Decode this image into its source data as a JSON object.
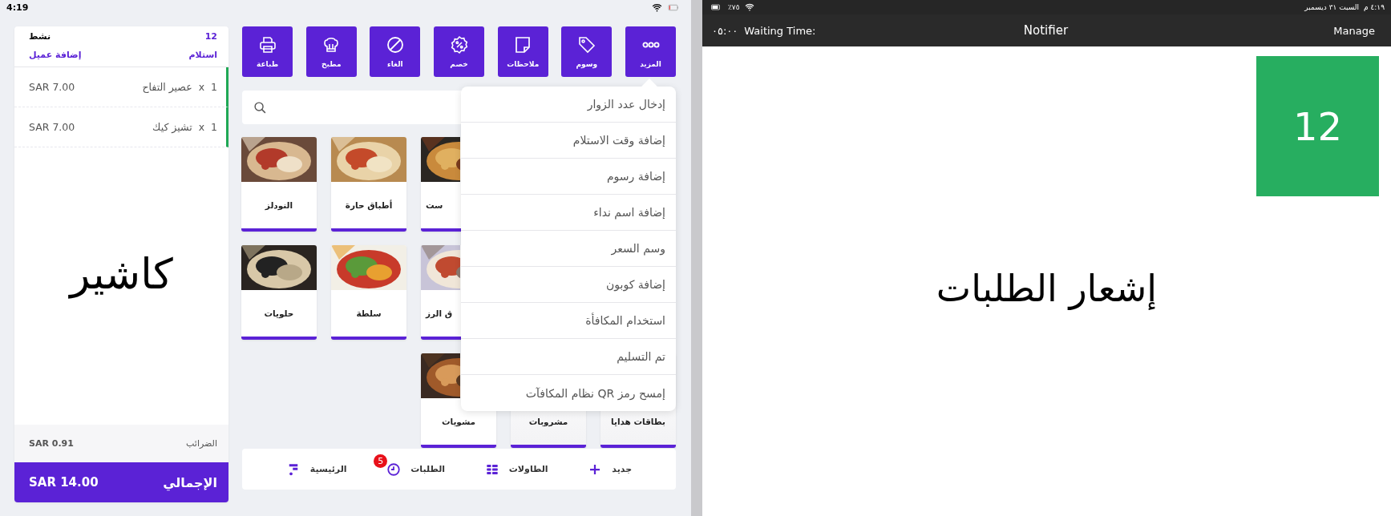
{
  "cashier": {
    "status_bar": {
      "time": "4:19"
    },
    "order": {
      "number": "12",
      "status": "نشط",
      "mode": "استلام",
      "add_customer": "إضافة عميل",
      "items": [
        {
          "qty": "1",
          "times": "x",
          "name": "عصير التفاح",
          "price": "SAR 7.00",
          "marked": true
        },
        {
          "qty": "1",
          "times": "x",
          "name": "تشيز كيك",
          "price": "SAR 7.00",
          "marked": true
        }
      ],
      "caption": "كاشير",
      "tax": {
        "label": "الضرائب",
        "value": "SAR 0.91"
      },
      "total": {
        "label": "الإجمالي",
        "value": "SAR 14.00"
      }
    },
    "toolbar": [
      {
        "label": "المزيد",
        "kind": "more"
      },
      {
        "label": "وسوم",
        "kind": "tags"
      },
      {
        "label": "ملاحظات",
        "kind": "notes"
      },
      {
        "label": "خصم",
        "kind": "discount"
      },
      {
        "label": "الغاء",
        "kind": "cancel"
      },
      {
        "label": "مطبخ",
        "kind": "kitchen"
      },
      {
        "label": "طباعة",
        "kind": "print"
      }
    ],
    "categories": [
      [
        {
          "name": "ست",
          "kind": "cut"
        },
        {
          "name": "أطباق حارة",
          "kind": "full"
        },
        {
          "name": "النودلز",
          "kind": "full"
        }
      ],
      [
        {
          "name": "ق الرز",
          "kind": "cut"
        },
        {
          "name": "سلطة",
          "kind": "full"
        },
        {
          "name": "حلويات",
          "kind": "full"
        }
      ],
      [
        {
          "name": "بطاقات هدايا",
          "kind": "covered"
        },
        {
          "name": "مشروبات",
          "kind": "covered"
        },
        {
          "name": "مشويات",
          "kind": "picture_cut"
        }
      ]
    ],
    "menu": [
      "إدخال عدد الزوار",
      "إضافة وقت الاستلام",
      "إضافة رسوم",
      "إضافة اسم نداء",
      "وسم السعر",
      "إضافة كوبون",
      "استخدام المكافأة",
      "تم التسليم",
      "إمسح رمز QR نظام المكافآت"
    ],
    "nav": [
      {
        "label": "جديد",
        "kind": "plus"
      },
      {
        "label": "الطاولات",
        "kind": "tables"
      },
      {
        "label": "الطلبات",
        "kind": "clock",
        "badge": "5"
      },
      {
        "label": "الرئيسية",
        "kind": "logo"
      }
    ]
  },
  "notifier": {
    "status_bar": {
      "time": "٤:١٩ م",
      "date": "السبت ٣١ ديسمبر",
      "battery": "٧٥٪"
    },
    "header": {
      "waiting_value": "٠٥:٠٠",
      "waiting_label": "Waiting Time:",
      "title": "Notifier",
      "action": "Manage"
    },
    "orders": [
      {
        "number": "12"
      }
    ],
    "caption": "إشعار الطلبات"
  }
}
